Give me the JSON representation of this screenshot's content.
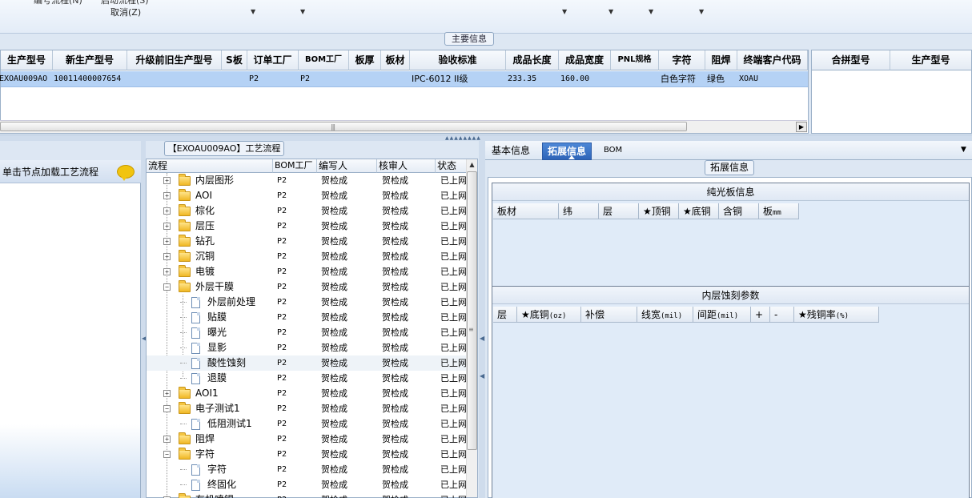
{
  "toolbar": {
    "cut_text_1": "编号流程(N)",
    "cut_text_2": "启动流程(S)",
    "cancel_label": "取消(Z)"
  },
  "main_info": {
    "section_title": "主要信息",
    "columns": [
      "生产型号",
      "新生产型号",
      "升级前旧生产型号",
      "S板",
      "订单工厂",
      "BOM工厂",
      "板厚",
      "板材",
      "验收标准",
      "成品长度",
      "成品宽度",
      "PNL规格",
      "字符",
      "阻焊",
      "终端客户代码"
    ],
    "row": {
      "production_model": "EXOAU009AO",
      "new_production_model": "10011400007654",
      "old_production_model": "",
      "s_board": "",
      "order_factory": "P2",
      "bom_factory": "P2",
      "thickness": "",
      "material": "",
      "acceptance_standard": "IPC-6012 II级",
      "length": "233.35",
      "width": "160.00",
      "pnl_spec": "",
      "char": "白色字符",
      "solder_mask": "绿色",
      "customer_code": "XOAU"
    },
    "side_columns": [
      "合拼型号",
      "生产型号"
    ]
  },
  "left_panel": {
    "tip": "单击节点加载工艺流程"
  },
  "process": {
    "title": "【EXOAU009AO】工艺流程",
    "columns": [
      "流程",
      "BOM工厂",
      "编写人",
      "核审人",
      "状态"
    ],
    "rows": [
      {
        "name": "内层图形",
        "type": "folder",
        "expand": "+",
        "bom": "P2",
        "writer": "贺检成",
        "reviewer": "贺检成",
        "status": "已上网"
      },
      {
        "name": "AOI",
        "type": "folder",
        "expand": "+",
        "bom": "P2",
        "writer": "贺检成",
        "reviewer": "贺检成",
        "status": "已上网"
      },
      {
        "name": "棕化",
        "type": "folder",
        "expand": "+",
        "bom": "P2",
        "writer": "贺检成",
        "reviewer": "贺检成",
        "status": "已上网"
      },
      {
        "name": "层压",
        "type": "folder",
        "expand": "+",
        "bom": "P2",
        "writer": "贺检成",
        "reviewer": "贺检成",
        "status": "已上网"
      },
      {
        "name": "钻孔",
        "type": "folder",
        "expand": "+",
        "bom": "P2",
        "writer": "贺检成",
        "reviewer": "贺检成",
        "status": "已上网"
      },
      {
        "name": "沉铜",
        "type": "folder",
        "expand": "+",
        "bom": "P2",
        "writer": "贺检成",
        "reviewer": "贺检成",
        "status": "已上网"
      },
      {
        "name": "电镀",
        "type": "folder",
        "expand": "+",
        "bom": "P2",
        "writer": "贺检成",
        "reviewer": "贺检成",
        "status": "已上网"
      },
      {
        "name": "外层干膜",
        "type": "folder",
        "expand": "-",
        "bom": "P2",
        "writer": "贺检成",
        "reviewer": "贺检成",
        "status": "已上网"
      },
      {
        "name": "外层前处理",
        "type": "doc",
        "bom": "P2",
        "writer": "贺检成",
        "reviewer": "贺检成",
        "status": "已上网"
      },
      {
        "name": "贴膜",
        "type": "doc",
        "bom": "P2",
        "writer": "贺检成",
        "reviewer": "贺检成",
        "status": "已上网"
      },
      {
        "name": "曝光",
        "type": "doc",
        "bom": "P2",
        "writer": "贺检成",
        "reviewer": "贺检成",
        "status": "已上网"
      },
      {
        "name": "显影",
        "type": "doc",
        "bom": "P2",
        "writer": "贺检成",
        "reviewer": "贺检成",
        "status": "已上网"
      },
      {
        "name": "酸性蚀刻",
        "type": "doc",
        "bom": "P2",
        "writer": "贺检成",
        "reviewer": "贺检成",
        "status": "已上网",
        "selected": true
      },
      {
        "name": "退膜",
        "type": "doc",
        "bom": "P2",
        "writer": "贺检成",
        "reviewer": "贺检成",
        "status": "已上网"
      },
      {
        "name": "AOI1",
        "type": "folder",
        "expand": "+",
        "bom": "P2",
        "writer": "贺检成",
        "reviewer": "贺检成",
        "status": "已上网"
      },
      {
        "name": "电子测试1",
        "type": "folder",
        "expand": "-",
        "bom": "P2",
        "writer": "贺检成",
        "reviewer": "贺检成",
        "status": "已上网"
      },
      {
        "name": "低阻测试1",
        "type": "doc",
        "bom": "P2",
        "writer": "贺检成",
        "reviewer": "贺检成",
        "status": "已上网"
      },
      {
        "name": "阻焊",
        "type": "folder",
        "expand": "+",
        "bom": "P2",
        "writer": "贺检成",
        "reviewer": "贺检成",
        "status": "已上网"
      },
      {
        "name": "字符",
        "type": "folder",
        "expand": "-",
        "bom": "P2",
        "writer": "贺检成",
        "reviewer": "贺检成",
        "status": "已上网"
      },
      {
        "name": "字符",
        "type": "doc",
        "bom": "P2",
        "writer": "贺检成",
        "reviewer": "贺检成",
        "status": "已上网"
      },
      {
        "name": "终固化",
        "type": "doc",
        "bom": "P2",
        "writer": "贺检成",
        "reviewer": "贺检成",
        "status": "已上网"
      },
      {
        "name": "有机喷锡",
        "type": "folder",
        "expand": "+",
        "bom": "P2",
        "writer": "贺检成",
        "reviewer": "贺检成",
        "status": "已上网"
      }
    ]
  },
  "right_panel": {
    "tabs": [
      "基本信息",
      "拓展信息",
      "BOM"
    ],
    "active_tab": 1,
    "ext_title": "拓展信息",
    "section1": {
      "title": "纯光板信息",
      "columns": [
        {
          "label": "板材"
        },
        {
          "label": "纬"
        },
        {
          "label": "层"
        },
        {
          "label": "★顶铜"
        },
        {
          "label": "★底铜"
        },
        {
          "label": "含铜"
        },
        {
          "label": "板",
          "unit": "mm"
        }
      ]
    },
    "section2": {
      "title": "内层蚀刻参数",
      "columns": [
        {
          "label": "层"
        },
        {
          "label": "★底铜",
          "unit": "(oz)"
        },
        {
          "label": "补偿"
        },
        {
          "label": "线宽",
          "unit": "(mil)"
        },
        {
          "label": "间距",
          "unit": "(mil)"
        },
        {
          "label": "+"
        },
        {
          "label": "-"
        },
        {
          "label": "★残铜率",
          "unit": "(%)"
        }
      ]
    }
  },
  "colors": {
    "selected_row": "#b5d2f5",
    "active_tab": "#2e64b8",
    "panel_bg": "#dde7f3",
    "section_bg": "#e0ebf8"
  }
}
